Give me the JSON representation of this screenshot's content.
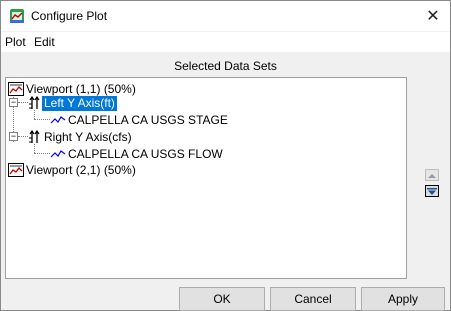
{
  "window": {
    "title": "Configure Plot",
    "close_glyph": "✕",
    "icon": "plot-app-icon"
  },
  "menu": [
    {
      "label": "Plot"
    },
    {
      "label": "Edit"
    }
  ],
  "section_title": "Selected Data Sets",
  "tree": {
    "viewport1": {
      "label": "Viewport (1,1) (50%)",
      "icon": "viewport-icon"
    },
    "left_axis": {
      "label": "Left Y Axis(ft)",
      "selected": true,
      "icon": "axis-icon"
    },
    "series1": {
      "label": "CALPELLA CA USGS STAGE",
      "icon": "line-series-icon"
    },
    "right_axis": {
      "label": "Right Y Axis(cfs)",
      "icon": "axis-icon"
    },
    "series2": {
      "label": "CALPELLA CA USGS FLOW",
      "icon": "line-series-icon"
    },
    "viewport2": {
      "label": "Viewport (2,1) (50%)",
      "icon": "viewport-icon"
    }
  },
  "buttons": {
    "ok": "OK",
    "cancel": "Cancel",
    "apply": "Apply"
  },
  "colors": {
    "selection": "#0078d7",
    "series_line": "#0000ff",
    "viewport_icon": "#cc0000"
  }
}
